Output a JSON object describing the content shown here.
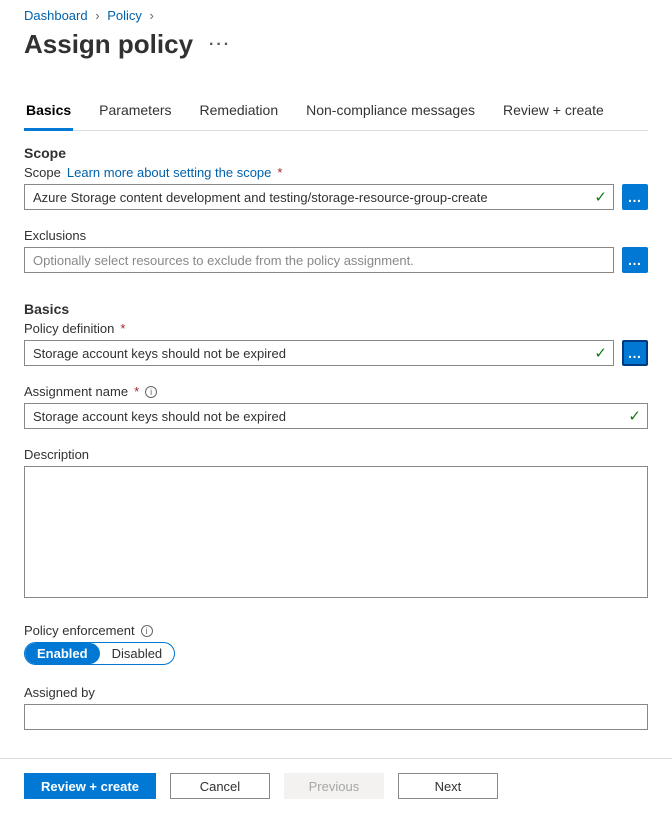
{
  "breadcrumb": {
    "dashboard": "Dashboard",
    "policy": "Policy"
  },
  "page_title": "Assign policy",
  "tabs": {
    "basics": "Basics",
    "parameters": "Parameters",
    "remediation": "Remediation",
    "noncompliance": "Non-compliance messages",
    "review": "Review + create"
  },
  "scope_section": {
    "heading": "Scope",
    "scope_label": "Scope",
    "learn_link": "Learn more about setting the scope",
    "scope_value": "Azure Storage content development and testing/storage-resource-group-create",
    "exclusions_label": "Exclusions",
    "exclusions_placeholder": "Optionally select resources to exclude from the policy assignment."
  },
  "basics_section": {
    "heading": "Basics",
    "policy_def_label": "Policy definition",
    "policy_def_value": "Storage account keys should not be expired",
    "assignment_label": "Assignment name",
    "assignment_value": "Storage account keys should not be expired",
    "description_label": "Description",
    "enforcement_label": "Policy enforcement",
    "enforcement_enabled": "Enabled",
    "enforcement_disabled": "Disabled",
    "assigned_by_label": "Assigned by"
  },
  "footer": {
    "review": "Review + create",
    "cancel": "Cancel",
    "previous": "Previous",
    "next": "Next"
  }
}
